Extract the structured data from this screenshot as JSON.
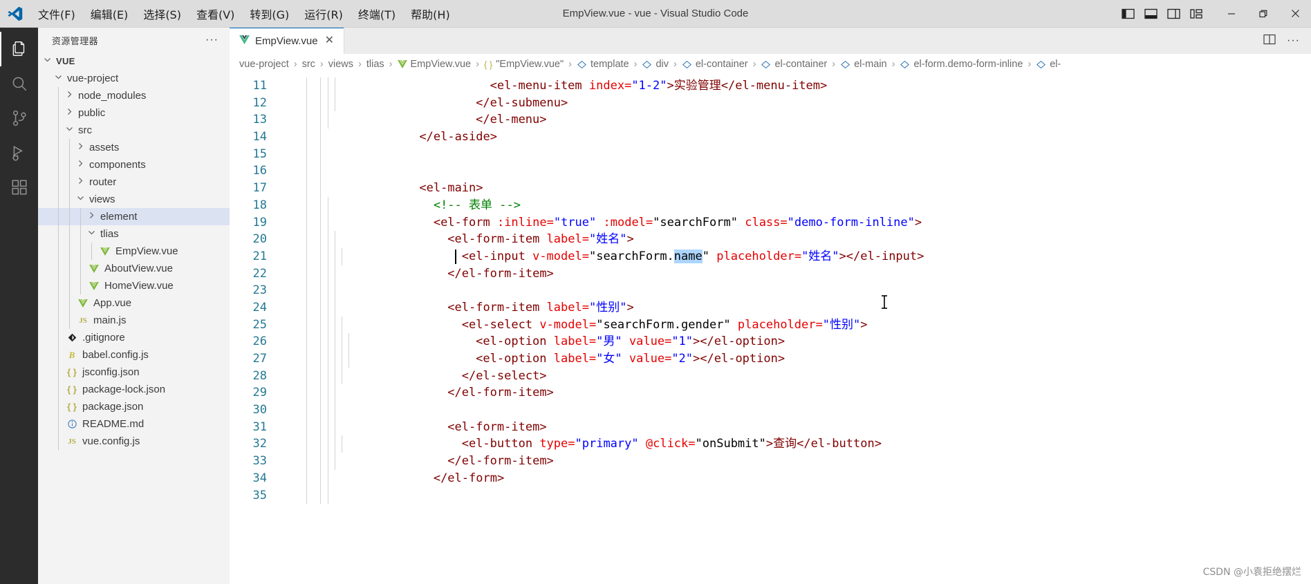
{
  "titlebar": {
    "logo_icon": "vscode-logo-icon",
    "menus": [
      {
        "label": "文件(F)",
        "name": "menu-file"
      },
      {
        "label": "编辑(E)",
        "name": "menu-edit"
      },
      {
        "label": "选择(S)",
        "name": "menu-selection"
      },
      {
        "label": "查看(V)",
        "name": "menu-view"
      },
      {
        "label": "转到(G)",
        "name": "menu-goto"
      },
      {
        "label": "运行(R)",
        "name": "menu-run"
      },
      {
        "label": "终端(T)",
        "name": "menu-terminal"
      },
      {
        "label": "帮助(H)",
        "name": "menu-help"
      }
    ],
    "window_title": "EmpView.vue - vue - Visual Studio Code",
    "layout_icons": [
      "toggle-primary-sidebar-icon",
      "toggle-panel-icon",
      "toggle-secondary-sidebar-icon",
      "customize-layout-icon"
    ],
    "window_buttons": [
      {
        "name": "minimize-button",
        "glyph": "─"
      },
      {
        "name": "restore-button",
        "glyph": "❐"
      },
      {
        "name": "close-button",
        "glyph": "✕"
      }
    ]
  },
  "activitybar": {
    "items": [
      {
        "name": "activity-explorer",
        "icon": "files-icon",
        "active": true
      },
      {
        "name": "activity-search",
        "icon": "search-icon",
        "active": false
      },
      {
        "name": "activity-source-control",
        "icon": "source-control-icon",
        "active": false
      },
      {
        "name": "activity-run-debug",
        "icon": "run-and-debug-icon",
        "active": false
      },
      {
        "name": "activity-extensions",
        "icon": "extensions-icon",
        "active": false
      }
    ]
  },
  "explorer": {
    "title": "资源管理器",
    "more_actions": "···",
    "root": "VUE",
    "tree": [
      {
        "label": "vue-project",
        "type": "folder",
        "state": "expanded",
        "depth": 1
      },
      {
        "label": "node_modules",
        "type": "folder",
        "state": "collapsed",
        "depth": 2
      },
      {
        "label": "public",
        "type": "folder",
        "state": "collapsed",
        "depth": 2
      },
      {
        "label": "src",
        "type": "folder",
        "state": "expanded",
        "depth": 2
      },
      {
        "label": "assets",
        "type": "folder",
        "state": "collapsed",
        "depth": 3
      },
      {
        "label": "components",
        "type": "folder",
        "state": "collapsed",
        "depth": 3
      },
      {
        "label": "router",
        "type": "folder",
        "state": "collapsed",
        "depth": 3
      },
      {
        "label": "views",
        "type": "folder",
        "state": "expanded",
        "depth": 3
      },
      {
        "label": "element",
        "type": "folder",
        "state": "collapsed",
        "depth": 4,
        "selected": true
      },
      {
        "label": "tlias",
        "type": "folder",
        "state": "expanded",
        "depth": 4
      },
      {
        "label": "EmpView.vue",
        "type": "vue",
        "depth": 5
      },
      {
        "label": "AboutView.vue",
        "type": "vue",
        "depth": 4
      },
      {
        "label": "HomeView.vue",
        "type": "vue",
        "depth": 4
      },
      {
        "label": "App.vue",
        "type": "vue",
        "depth": 3
      },
      {
        "label": "main.js",
        "type": "js",
        "depth": 3
      },
      {
        "label": ".gitignore",
        "type": "git",
        "depth": 2
      },
      {
        "label": "babel.config.js",
        "type": "babel",
        "depth": 2
      },
      {
        "label": "jsconfig.json",
        "type": "json",
        "depth": 2
      },
      {
        "label": "package-lock.json",
        "type": "json",
        "depth": 2
      },
      {
        "label": "package.json",
        "type": "json",
        "depth": 2
      },
      {
        "label": "README.md",
        "type": "md",
        "depth": 2
      },
      {
        "label": "vue.config.js",
        "type": "js",
        "depth": 2
      }
    ]
  },
  "tabs": [
    {
      "label": "EmpView.vue",
      "icon": "vue-file-icon",
      "close": "✕",
      "active": true
    }
  ],
  "tab_actions": [
    {
      "name": "split-editor-right-icon",
      "glyph": "split"
    },
    {
      "name": "more-actions-icon",
      "glyph": "···"
    }
  ],
  "breadcrumbs": [
    {
      "label": "vue-project",
      "icon": null
    },
    {
      "label": "src",
      "icon": null
    },
    {
      "label": "views",
      "icon": null
    },
    {
      "label": "tlias",
      "icon": null
    },
    {
      "label": "EmpView.vue",
      "icon": "vue-file-icon"
    },
    {
      "label": "\"EmpView.vue\"",
      "icon": "json-braces-icon"
    },
    {
      "label": "template",
      "icon": "symbol-field-icon"
    },
    {
      "label": "div",
      "icon": "symbol-field-icon"
    },
    {
      "label": "el-container",
      "icon": "symbol-field-icon"
    },
    {
      "label": "el-container",
      "icon": "symbol-field-icon"
    },
    {
      "label": "el-main",
      "icon": "symbol-field-icon"
    },
    {
      "label": "el-form.demo-form-inline",
      "icon": "symbol-field-icon"
    },
    {
      "label": "el-",
      "icon": "symbol-field-icon"
    }
  ],
  "editor": {
    "first_visible_line": 11,
    "lines": [
      {
        "num": 11,
        "clipped": true,
        "indents": [
          4,
          6,
          7,
          8
        ],
        "tokens": [
          {
            "t": "<el-menu-item",
            "c": "tag",
            "pad": 30
          },
          {
            "t": " index=",
            "c": "attr"
          },
          {
            "t": "\"1-2\"",
            "c": "val"
          },
          {
            "t": ">实验管理</el-menu-item>",
            "c": "tag"
          }
        ]
      },
      {
        "num": 12,
        "indents": [
          4,
          6,
          7,
          8
        ],
        "tokens": [
          {
            "t": "</el-submenu>",
            "c": "tag",
            "pad": 28
          }
        ]
      },
      {
        "num": 13,
        "indents": [
          4,
          6,
          7
        ],
        "tokens": [
          {
            "t": "</el-menu>",
            "c": "tag",
            "pad": 28
          }
        ]
      },
      {
        "num": 14,
        "indents": [
          4,
          6
        ],
        "tokens": [
          {
            "t": "</el-aside>",
            "c": "tag",
            "pad": 20
          }
        ]
      },
      {
        "num": 15,
        "indents": [
          4,
          6
        ],
        "tokens": []
      },
      {
        "num": 16,
        "indents": [
          4,
          6
        ],
        "tokens": []
      },
      {
        "num": 17,
        "indents": [
          4,
          6
        ],
        "tokens": [
          {
            "t": "<el-main>",
            "c": "tag",
            "pad": 20
          }
        ]
      },
      {
        "num": 18,
        "indents": [
          4,
          6,
          7
        ],
        "tokens": [
          {
            "t": "<!-- 表单 -->",
            "c": "cmt",
            "pad": 22
          }
        ]
      },
      {
        "num": 19,
        "indents": [
          4,
          6,
          7
        ],
        "tokens": [
          {
            "t": "<el-form",
            "c": "tag",
            "pad": 22
          },
          {
            "t": " :inline=",
            "c": "attr"
          },
          {
            "t": "\"true\"",
            "c": "val"
          },
          {
            "t": " :model=",
            "c": "attr"
          },
          {
            "t": "\"searchForm\"",
            "c": "plain"
          },
          {
            "t": " class=",
            "c": "attr"
          },
          {
            "t": "\"demo-form-inline\"",
            "c": "val"
          },
          {
            "t": ">",
            "c": "tag"
          }
        ]
      },
      {
        "num": 20,
        "indents": [
          4,
          6,
          7,
          8
        ],
        "tokens": [
          {
            "t": "<el-form-item",
            "c": "tag",
            "pad": 24
          },
          {
            "t": " label=",
            "c": "attr"
          },
          {
            "t": "\"姓名\"",
            "c": "val"
          },
          {
            "t": ">",
            "c": "tag"
          }
        ]
      },
      {
        "num": 21,
        "indents": [
          4,
          6,
          7,
          8,
          9
        ],
        "tokens": [
          {
            "t": "<el-input",
            "c": "tag",
            "pad": 26
          },
          {
            "t": " v-model=",
            "c": "attr"
          },
          {
            "t": "\"searchForm.",
            "c": "plain"
          },
          {
            "t": "name",
            "c": "sel"
          },
          {
            "t": "\"",
            "c": "plain"
          },
          {
            "t": " placeholder=",
            "c": "attr"
          },
          {
            "t": "\"姓名\"",
            "c": "val"
          },
          {
            "t": "></el-input>",
            "c": "tag"
          }
        ]
      },
      {
        "num": 22,
        "indents": [
          4,
          6,
          7,
          8
        ],
        "tokens": [
          {
            "t": "</el-form-item>",
            "c": "tag",
            "pad": 24
          }
        ]
      },
      {
        "num": 23,
        "indents": [
          4,
          6,
          7,
          8
        ],
        "tokens": []
      },
      {
        "num": 24,
        "indents": [
          4,
          6,
          7,
          8
        ],
        "tokens": [
          {
            "t": "<el-form-item",
            "c": "tag",
            "pad": 24
          },
          {
            "t": " label=",
            "c": "attr"
          },
          {
            "t": "\"性别\"",
            "c": "val"
          },
          {
            "t": ">",
            "c": "tag"
          }
        ]
      },
      {
        "num": 25,
        "indents": [
          4,
          6,
          7,
          8,
          9
        ],
        "tokens": [
          {
            "t": "<el-select",
            "c": "tag",
            "pad": 26
          },
          {
            "t": " v-model=",
            "c": "attr"
          },
          {
            "t": "\"searchForm.gender\"",
            "c": "plain"
          },
          {
            "t": " placeholder=",
            "c": "attr"
          },
          {
            "t": "\"性别\"",
            "c": "val"
          },
          {
            "t": ">",
            "c": "tag"
          }
        ]
      },
      {
        "num": 26,
        "indents": [
          4,
          6,
          7,
          8,
          9,
          10
        ],
        "tokens": [
          {
            "t": "<el-option",
            "c": "tag",
            "pad": 28
          },
          {
            "t": " label=",
            "c": "attr"
          },
          {
            "t": "\"男\"",
            "c": "val"
          },
          {
            "t": " value=",
            "c": "attr"
          },
          {
            "t": "\"1\"",
            "c": "val"
          },
          {
            "t": "></el-option>",
            "c": "tag"
          }
        ]
      },
      {
        "num": 27,
        "indents": [
          4,
          6,
          7,
          8,
          9,
          10
        ],
        "tokens": [
          {
            "t": "<el-option",
            "c": "tag",
            "pad": 28
          },
          {
            "t": " label=",
            "c": "attr"
          },
          {
            "t": "\"女\"",
            "c": "val"
          },
          {
            "t": " value=",
            "c": "attr"
          },
          {
            "t": "\"2\"",
            "c": "val"
          },
          {
            "t": "></el-option>",
            "c": "tag"
          }
        ]
      },
      {
        "num": 28,
        "indents": [
          4,
          6,
          7,
          8,
          9
        ],
        "tokens": [
          {
            "t": "</el-select>",
            "c": "tag",
            "pad": 26
          }
        ]
      },
      {
        "num": 29,
        "indents": [
          4,
          6,
          7,
          8
        ],
        "tokens": [
          {
            "t": "</el-form-item>",
            "c": "tag",
            "pad": 24
          }
        ]
      },
      {
        "num": 30,
        "indents": [
          4,
          6,
          7,
          8
        ],
        "tokens": []
      },
      {
        "num": 31,
        "indents": [
          4,
          6,
          7,
          8
        ],
        "tokens": [
          {
            "t": "<el-form-item>",
            "c": "tag",
            "pad": 24
          }
        ]
      },
      {
        "num": 32,
        "indents": [
          4,
          6,
          7,
          8,
          9
        ],
        "tokens": [
          {
            "t": "<el-button",
            "c": "tag",
            "pad": 26
          },
          {
            "t": " type=",
            "c": "attr"
          },
          {
            "t": "\"primary\"",
            "c": "val"
          },
          {
            "t": " @click=",
            "c": "attr"
          },
          {
            "t": "\"onSubmit\"",
            "c": "plain"
          },
          {
            "t": ">查询</el-button>",
            "c": "tag"
          }
        ]
      },
      {
        "num": 33,
        "indents": [
          4,
          6,
          7,
          8
        ],
        "tokens": [
          {
            "t": "</el-form-item>",
            "c": "tag",
            "pad": 24
          }
        ]
      },
      {
        "num": 34,
        "indents": [
          4,
          6,
          7
        ],
        "tokens": [
          {
            "t": "</el-form>",
            "c": "tag",
            "pad": 22
          }
        ]
      },
      {
        "num": 35,
        "indents": [
          4,
          6,
          7
        ],
        "tokens": []
      }
    ]
  },
  "watermark": "CSDN @小袁拒绝摆烂",
  "colors": {
    "titlebar_bg": "#dddddd",
    "activitybar_bg": "#2c2c2c",
    "explorer_bg": "#f3f3f3",
    "tabsbar_bg": "#ececec",
    "editor_bg": "#ffffff",
    "line_number": "#237893",
    "selection": "#add6ff",
    "tab_active_border": "#0066b8",
    "tree_selected": "#dbe2f2",
    "syntax_tag": "#800000",
    "syntax_attr": "#e50000",
    "syntax_value": "#0000ff",
    "syntax_comment": "#008000",
    "vue_green": "#41b883"
  }
}
